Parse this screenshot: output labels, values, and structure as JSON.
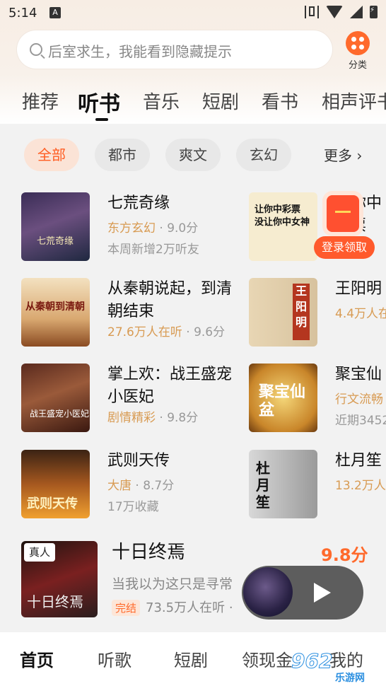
{
  "status": {
    "time": "5:14",
    "notif_icon": "A"
  },
  "search": {
    "placeholder": "后室求生，我能看到隐藏提示"
  },
  "category_button": {
    "label": "分类"
  },
  "tabs": [
    "推荐",
    "听书",
    "音乐",
    "短剧",
    "看书",
    "相声评书"
  ],
  "active_tab": "听书",
  "chips": [
    "全部",
    "都市",
    "爽文",
    "玄幻"
  ],
  "chips_more": "更多",
  "books_left": [
    {
      "title": "七荒奇缘",
      "tag": "东方玄幻",
      "meta": " · 9.0分",
      "extra": "本周新增2万听友",
      "cover_text": "七荒奇缘"
    },
    {
      "title": "从秦朝说起，到清朝结束",
      "tag": "27.6万人在听",
      "meta": " · 9.6分",
      "extra": "",
      "cover_text": "从秦朝到清朝"
    },
    {
      "title": "掌上欢：战王盛宠小医妃",
      "tag": "剧情精彩",
      "meta": " · 9.8分",
      "extra": "",
      "cover_text": "战王盛宠小医妃"
    },
    {
      "title": "武则天传",
      "tag": "大唐",
      "meta": " · 8.7分",
      "extra": "17万收藏",
      "cover_text": "武则天传"
    }
  ],
  "books_right": [
    {
      "title": "让你中彩票",
      "tag": "",
      "meta": "",
      "extra": "",
      "cover_text": "让你中彩票 没让你中女神"
    },
    {
      "title": "王阳明",
      "tag": "4.4万人在",
      "meta": "",
      "extra": "",
      "cover_text": "王阳明"
    },
    {
      "title": "聚宝仙",
      "tag": "行文流畅",
      "meta": "",
      "extra": "近期3452",
      "cover_text": "聚宝仙盆"
    },
    {
      "title": "杜月笙",
      "tag": "13.2万人",
      "meta": "",
      "extra": "",
      "cover_text": "杜月笙"
    }
  ],
  "promo": {
    "label": "登录领取"
  },
  "featured": {
    "badge": "真人",
    "title": "十日终焉",
    "score": "9.8分",
    "desc": "当我以为这只是寻常",
    "status": "完结",
    "listeners": "73.5万人在听 ·",
    "cover_text": "十日终焉"
  },
  "bottom_nav": [
    "首页",
    "听歌",
    "短剧",
    "领现金",
    "我的"
  ],
  "watermark": {
    "logo": "962",
    "text": "乐游网"
  },
  "colors": {
    "accent": "#ff5d22",
    "tag": "#d89b53"
  }
}
